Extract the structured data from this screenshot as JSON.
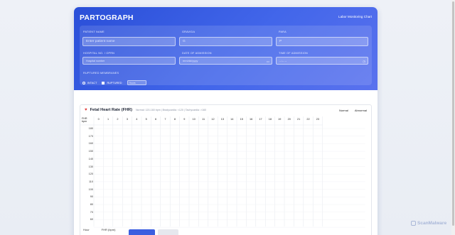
{
  "header": {
    "title": "PARTOGRAPH",
    "subtitle": "Labor Monitoring Chart"
  },
  "form": {
    "patient_name": {
      "label": "PATIENT NAME",
      "placeholder": "Enter patient name"
    },
    "gravida": {
      "label": "GRAVIDA",
      "value": "G"
    },
    "para": {
      "label": "PARA",
      "value": "P"
    },
    "hospital_no": {
      "label": "HOSPITAL NO. / OPRN",
      "placeholder": "Hospital number"
    },
    "date_admission": {
      "label": "DATE OF ADMISSION",
      "value": "mm/dd/yyyy"
    },
    "time_admission": {
      "label": "TIME OF ADMISSION",
      "value": "--:-- --"
    },
    "membranes": {
      "label": "RUPTURED MEMBRANES",
      "intact": "INTACT",
      "ruptured": "RUPTURED",
      "hours_placeholder": "Hours"
    }
  },
  "chart": {
    "title": "Fetal Heart Rate (FHR)",
    "meta": "Normal: 120-160 bpm | Bradycardia: <120 | Tachycardia: >160",
    "legend": {
      "normal": "Normal",
      "abnormal": "Abnormal"
    },
    "corner_label_1": "FHR",
    "corner_label_2": "bpm"
  },
  "chart_data": {
    "type": "table",
    "columns": [
      "0",
      "1",
      "2",
      "3",
      "4",
      "5",
      "6",
      "7",
      "8",
      "9",
      "10",
      "11",
      "12",
      "13",
      "14",
      "15",
      "16",
      "17",
      "18",
      "19",
      "20",
      "21",
      "22",
      "23"
    ],
    "rows": [
      "180",
      "170",
      "160",
      "150",
      "140",
      "130",
      "120",
      "110",
      "100",
      "90",
      "80",
      "70",
      "60"
    ],
    "ylabel": "FHR bpm"
  },
  "bottom": {
    "hour_label": "Hour",
    "fhr_label": "FHR (bpm)"
  },
  "watermark": {
    "text": "ScanMalware"
  },
  "colors": {
    "header_start": "#2a4fd8",
    "header_end": "#5a72ee",
    "accent": "#3b5fe0",
    "heart": "#e03a3a"
  }
}
